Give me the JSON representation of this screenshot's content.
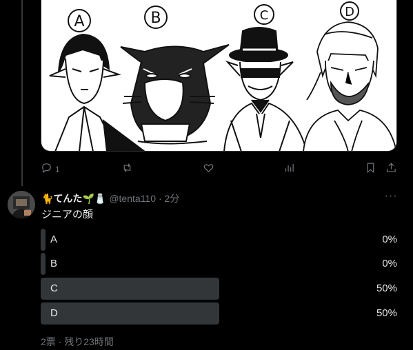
{
  "media": {
    "panel_letters": [
      "A",
      "B",
      "C",
      "D"
    ]
  },
  "actions": {
    "reply_count": "1",
    "icons": [
      "reply-icon",
      "retweet-icon",
      "like-icon",
      "views-icon",
      "bookmark-icon",
      "share-icon"
    ]
  },
  "tweet": {
    "display_name": "てんた",
    "name_emojis_before": "🐈",
    "name_emojis_after": "🌱🧂",
    "handle": "@tenta110",
    "time": "· 2分",
    "text": "ジニアの顔",
    "more_label": "···"
  },
  "poll": {
    "options": [
      {
        "label": "A",
        "percent": "0%",
        "fill": 0.0
      },
      {
        "label": "B",
        "percent": "0%",
        "fill": 0.0
      },
      {
        "label": "C",
        "percent": "50%",
        "fill": 0.5
      },
      {
        "label": "D",
        "percent": "50%",
        "fill": 0.5
      }
    ],
    "meta": "2票 · 残り23時間"
  },
  "colors": {
    "background": "#000000",
    "text": "#e7e9ea",
    "muted": "#71767b",
    "poll_bar": "#333639"
  }
}
